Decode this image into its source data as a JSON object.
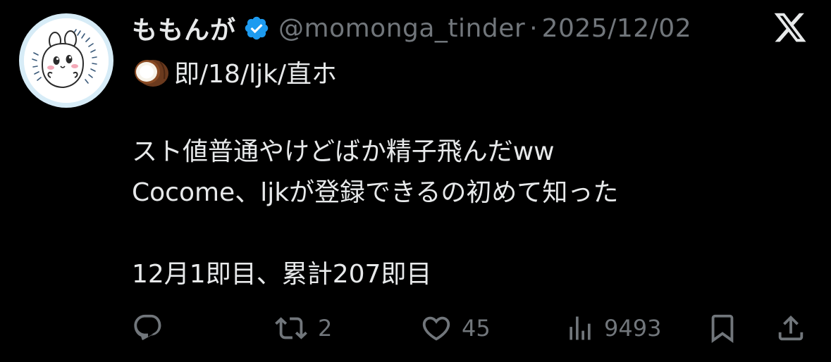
{
  "user": {
    "display_name": "ももんが",
    "handle": "@momonga_tinder",
    "separator": "·",
    "date": "2025/12/02",
    "verified_badge_color": "#1d9bf0"
  },
  "tweet": {
    "first_line_emoji": "coconut-emoji",
    "first_line_text": "即/18/ljk/直ホ",
    "line_2": "スト値普通やけどばか精子飛んだww",
    "line_3": "Cocome、ljkが登録できるの初めて知った",
    "line_4": "12月1即目、累計207即目"
  },
  "actions": {
    "reply_icon": "reply-icon",
    "retweet_count": "2",
    "like_count": "45",
    "views_count": "9493",
    "bookmark_icon": "bookmark-icon",
    "share_icon": "share-icon"
  },
  "colors": {
    "background": "#000000",
    "text_primary": "#e7e9ea",
    "text_secondary": "#71767b",
    "avatar_ring": "#d7ecf7"
  }
}
